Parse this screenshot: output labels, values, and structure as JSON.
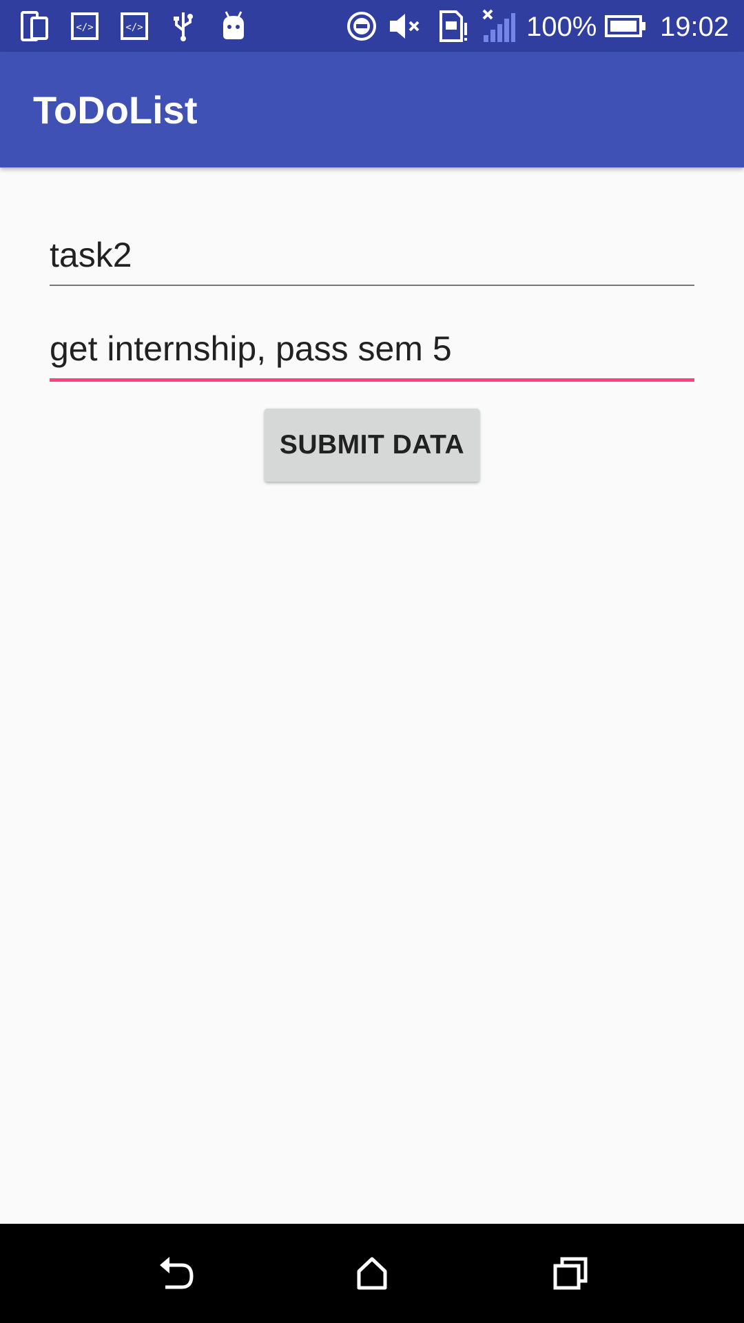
{
  "status_bar": {
    "battery_percent": "100%",
    "time": "19:02",
    "left_icons": [
      "device-icon",
      "code-icon",
      "code-icon",
      "usb-icon",
      "android-icon"
    ],
    "right_icons": [
      "do-not-disturb-icon",
      "volume-muted-icon",
      "sim-alert-icon",
      "signal-no-data-icon",
      "battery-icon"
    ]
  },
  "app_bar": {
    "title": "ToDoList"
  },
  "form": {
    "task_name_value": "task2",
    "task_description_value": "get internship, pass sem 5",
    "submit_label": "SUBMIT DATA"
  },
  "nav_bar": {
    "icons": [
      "back-icon",
      "home-icon",
      "recents-icon"
    ]
  },
  "colors": {
    "status_bar": "#303f9f",
    "app_bar": "#3f51b5",
    "accent": "#ff4081",
    "background": "#fafafa",
    "button": "#d6d7d7"
  }
}
